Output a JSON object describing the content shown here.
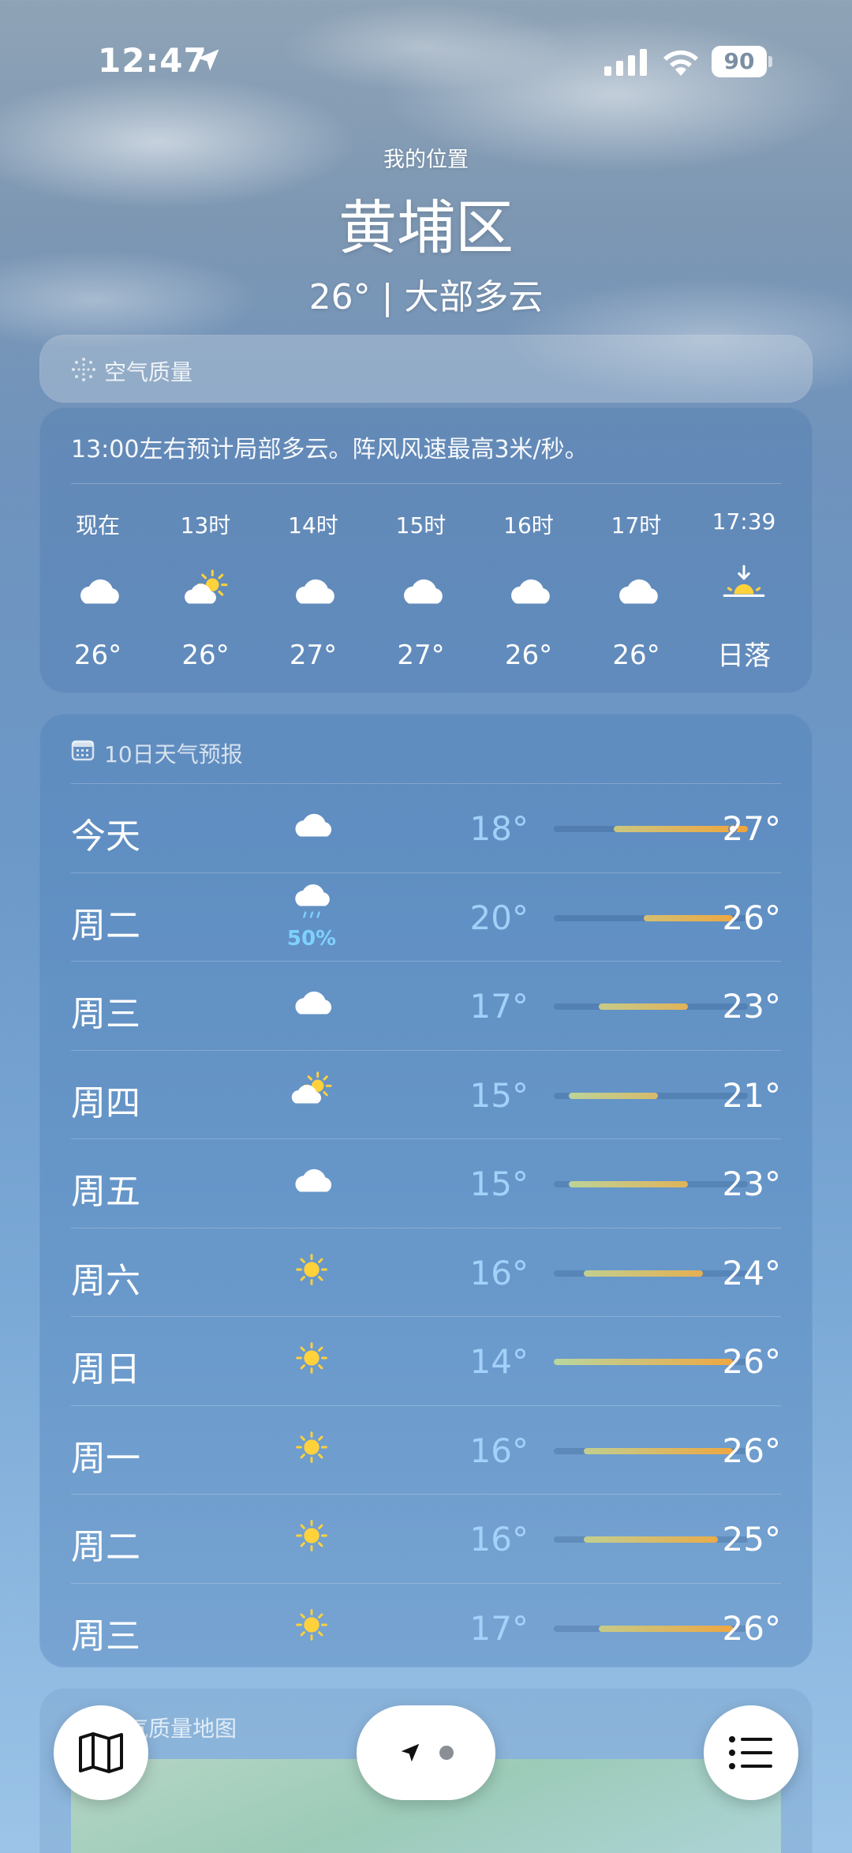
{
  "status_bar": {
    "time": "12:47",
    "battery": "90"
  },
  "header": {
    "location_label": "我的位置",
    "city": "黄埔区",
    "current": "26° | 大部多云"
  },
  "air_quality": {
    "label": "空气质量"
  },
  "hourly": {
    "summary": "13:00左右预计局部多云。阵风风速最高3米/秒。",
    "items": [
      {
        "hour": "现在",
        "icon": "cloud-icon",
        "temp": "26°"
      },
      {
        "hour": "13时",
        "icon": "partly-sunny-icon",
        "temp": "26°"
      },
      {
        "hour": "14时",
        "icon": "cloud-icon",
        "temp": "27°"
      },
      {
        "hour": "15时",
        "icon": "cloud-icon",
        "temp": "27°"
      },
      {
        "hour": "16时",
        "icon": "cloud-icon",
        "temp": "26°"
      },
      {
        "hour": "17时",
        "icon": "cloud-icon",
        "temp": "26°"
      },
      {
        "hour": "17:39",
        "icon": "sunset-icon",
        "temp": "日落"
      }
    ]
  },
  "ten_day": {
    "title": "10日天气预报",
    "range": [
      14,
      27
    ],
    "days": [
      {
        "day": "今天",
        "icon": "cloud-icon",
        "pop": "",
        "lo": "18°",
        "hi": "27°",
        "lo_v": 18,
        "hi_v": 27,
        "current_v": 26
      },
      {
        "day": "周二",
        "icon": "rain-cloud-icon",
        "pop": "50%",
        "lo": "20°",
        "hi": "26°",
        "lo_v": 20,
        "hi_v": 26
      },
      {
        "day": "周三",
        "icon": "cloud-icon",
        "pop": "",
        "lo": "17°",
        "hi": "23°",
        "lo_v": 17,
        "hi_v": 23
      },
      {
        "day": "周四",
        "icon": "partly-sunny-icon",
        "pop": "",
        "lo": "15°",
        "hi": "21°",
        "lo_v": 15,
        "hi_v": 21
      },
      {
        "day": "周五",
        "icon": "cloud-icon",
        "pop": "",
        "lo": "15°",
        "hi": "23°",
        "lo_v": 15,
        "hi_v": 23
      },
      {
        "day": "周六",
        "icon": "sun-icon",
        "pop": "",
        "lo": "16°",
        "hi": "24°",
        "lo_v": 16,
        "hi_v": 24
      },
      {
        "day": "周日",
        "icon": "sun-icon",
        "pop": "",
        "lo": "14°",
        "hi": "26°",
        "lo_v": 14,
        "hi_v": 26
      },
      {
        "day": "周一",
        "icon": "sun-icon",
        "pop": "",
        "lo": "16°",
        "hi": "26°",
        "lo_v": 16,
        "hi_v": 26
      },
      {
        "day": "周二",
        "icon": "sun-icon",
        "pop": "",
        "lo": "16°",
        "hi": "25°",
        "lo_v": 16,
        "hi_v": 25
      },
      {
        "day": "周三",
        "icon": "sun-icon",
        "pop": "",
        "lo": "17°",
        "hi": "26°",
        "lo_v": 17,
        "hi_v": 26
      }
    ]
  },
  "map_card": {
    "title": "空气质量地图"
  },
  "colors": {
    "sun": "#ffd23c",
    "pop": "#7fd1ff",
    "warm": "#f2a33a",
    "cool": "#b8d7a0"
  }
}
